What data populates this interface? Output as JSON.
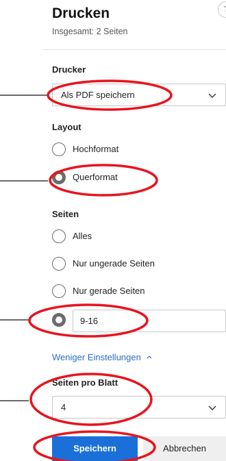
{
  "dialog": {
    "title": "Drucken",
    "subtitle": "Insgesamt: 2 Seiten"
  },
  "printer": {
    "label": "Drucker",
    "selected": "Als PDF speichern"
  },
  "layout": {
    "label": "Layout",
    "options": [
      {
        "label": "Hochformat",
        "checked": false
      },
      {
        "label": "Querformat",
        "checked": true
      }
    ]
  },
  "pages": {
    "label": "Seiten",
    "options": [
      {
        "label": "Alles",
        "checked": false
      },
      {
        "label": "Nur ungerade Seiten",
        "checked": false
      },
      {
        "label": "Nur gerade Seiten",
        "checked": false
      }
    ],
    "custom_range": {
      "checked": true,
      "value": "9-16"
    }
  },
  "toggle_link": "Weniger Einstellungen",
  "pages_per_sheet": {
    "label": "Seiten pro Blatt",
    "selected": "4"
  },
  "buttons": {
    "save": "Speichern",
    "cancel": "Abbrechen"
  },
  "colors": {
    "accent": "#1a6fd8",
    "annotation": "#e8141e",
    "link": "#2b6cc4"
  }
}
